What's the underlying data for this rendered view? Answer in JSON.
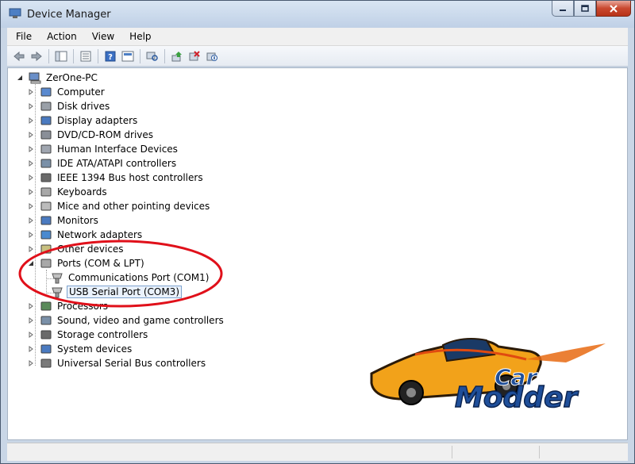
{
  "window": {
    "title": "Device Manager"
  },
  "menu": [
    "File",
    "Action",
    "View",
    "Help"
  ],
  "toolbar": {
    "buttons": [
      "back-icon",
      "forward-icon",
      "properties-pane-icon",
      "list-icon",
      "help-icon",
      "console-icon",
      "scan-hardware-icon",
      "update-driver-icon",
      "uninstall-icon",
      "disable-icon"
    ]
  },
  "tree": {
    "root": "ZerOne-PC",
    "items": [
      "Computer",
      "Disk drives",
      "Display adapters",
      "DVD/CD-ROM drives",
      "Human Interface Devices",
      "IDE ATA/ATAPI controllers",
      "IEEE 1394 Bus host controllers",
      "Keyboards",
      "Mice and other pointing devices",
      "Monitors",
      "Network adapters",
      "Other devices",
      "Ports (COM & LPT)",
      "Processors",
      "Sound, video and game controllers",
      "Storage controllers",
      "System devices",
      "Universal Serial Bus controllers"
    ],
    "ports_children": [
      "Communications Port (COM1)",
      "USB Serial Port (COM3)"
    ],
    "selected": "USB Serial Port (COM3)"
  },
  "annotation_color": "#e0101a",
  "logo": {
    "line1": "Car",
    "line2": "Modder"
  }
}
